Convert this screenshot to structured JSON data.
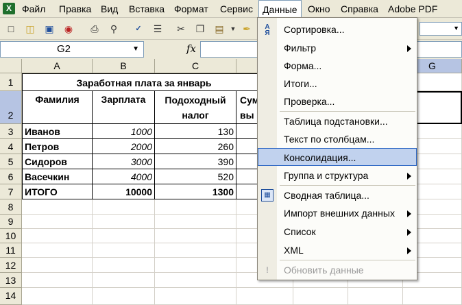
{
  "menubar": {
    "items": [
      "Файл",
      "Правка",
      "Вид",
      "Вставка",
      "Формат",
      "Сервис",
      "Данные",
      "Окно",
      "Справка",
      "Adobe PDF"
    ],
    "active": "Данные"
  },
  "formula_bar": {
    "name_box": "G2",
    "fx_label": "fx",
    "content": ""
  },
  "columns": [
    "A",
    "B",
    "C",
    "D",
    "E",
    "F",
    "G"
  ],
  "rows": [
    "1",
    "2",
    "3",
    "4",
    "5",
    "6",
    "7",
    "8",
    "9",
    "10",
    "11",
    "12",
    "13",
    "14"
  ],
  "sheet": {
    "title": "Заработная плата за январь",
    "headers": {
      "a": "Фамилия",
      "b": "Зарплата",
      "c1": "Подоходный",
      "c2": "налог",
      "d1": "Сум",
      "d2": "вы"
    },
    "data_rows": [
      {
        "name": "Иванов",
        "salary": "1000",
        "tax": "130"
      },
      {
        "name": "Петров",
        "salary": "2000",
        "tax": "260"
      },
      {
        "name": "Сидоров",
        "salary": "3000",
        "tax": "390"
      },
      {
        "name": "Васечкин",
        "salary": "4000",
        "tax": "520"
      }
    ],
    "total": {
      "name": "ИТОГО",
      "salary": "10000",
      "tax": "1300"
    }
  },
  "data_menu": {
    "items": [
      {
        "label": "Сортировка...",
        "icon": "sort-az-icon"
      },
      {
        "label": "Фильтр",
        "submenu": true
      },
      {
        "label": "Форма..."
      },
      {
        "label": "Итоги..."
      },
      {
        "label": "Проверка..."
      },
      {
        "label": "Таблица подстановки..."
      },
      {
        "label": "Текст по столбцам..."
      },
      {
        "label": "Консолидация...",
        "highlighted": true
      },
      {
        "label": "Группа и структура",
        "submenu": true
      },
      {
        "label": "Сводная таблица...",
        "icon": "pivot-table-icon"
      },
      {
        "label": "Импорт внешних данных",
        "submenu": true
      },
      {
        "label": "Список",
        "submenu": true
      },
      {
        "label": "XML",
        "submenu": true
      },
      {
        "label": "Обновить данные",
        "disabled": true,
        "icon": "refresh-exclamation-icon"
      }
    ]
  },
  "colors": {
    "menu_highlight": "#c1d2ee",
    "highlight_border": "#316ac5",
    "chrome": "#ece9d8"
  }
}
